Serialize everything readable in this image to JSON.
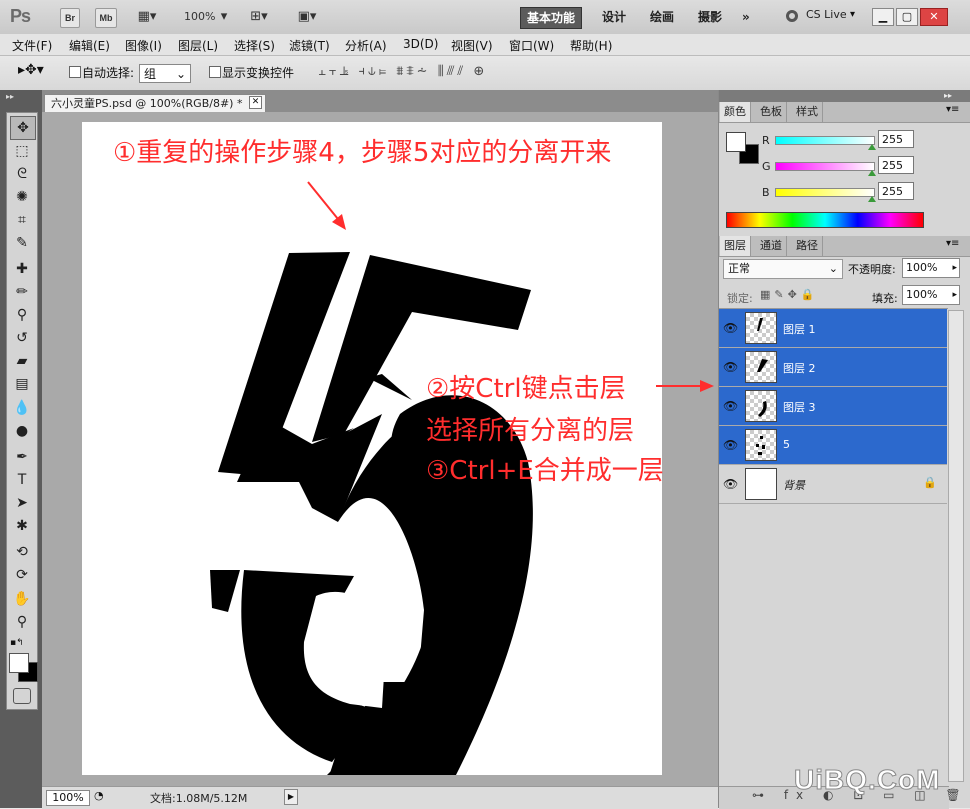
{
  "app": {
    "logo": "Ps",
    "bridge": "Br",
    "minibridge": "Mb",
    "zoom": "100%",
    "workspaces": [
      "基本功能",
      "设计",
      "绘画",
      "摄影"
    ],
    "more": "»",
    "cslive": "CS Live"
  },
  "menu": [
    "文件(F)",
    "编辑(E)",
    "图像(I)",
    "图层(L)",
    "选择(S)",
    "滤镜(T)",
    "分析(A)",
    "3D(D)",
    "视图(V)",
    "窗口(W)",
    "帮助(H)"
  ],
  "options": {
    "auto_select_label": "自动选择:",
    "auto_select_value": "组",
    "show_transform_label": "显示变换控件"
  },
  "document": {
    "tab_title": "六小灵童PS.psd @ 100%(RGB/8#) *",
    "status_zoom": "100%",
    "status_doc": "文档:1.08M/5.12M"
  },
  "annotations": {
    "a1": "①重复的操作步骤4，步骤5对应的分离开来",
    "a2": "②按Ctrl键点击层",
    "a3": "选择所有分离的层",
    "a4": "③Ctrl+E合并成一层"
  },
  "color_panel": {
    "tabs": [
      "颜色",
      "色板",
      "样式"
    ],
    "r_label": "R",
    "g_label": "G",
    "b_label": "B",
    "r": "255",
    "g": "255",
    "b": "255"
  },
  "layers_panel": {
    "tabs": [
      "图层",
      "通道",
      "路径"
    ],
    "blend_mode": "正常",
    "opacity_label": "不透明度:",
    "opacity": "100%",
    "lock_label": "锁定:",
    "fill_label": "填充:",
    "fill": "100%",
    "layers": [
      {
        "name": "图层 1",
        "selected": true
      },
      {
        "name": "图层 2",
        "selected": true
      },
      {
        "name": "图层 3",
        "selected": true
      },
      {
        "name": "5",
        "selected": true
      },
      {
        "name": "背景",
        "selected": false
      }
    ]
  },
  "watermark": "UiBQ.CoM",
  "colors": {
    "accent_selection": "#2c69cd",
    "annotation": "#ff2d2d"
  }
}
